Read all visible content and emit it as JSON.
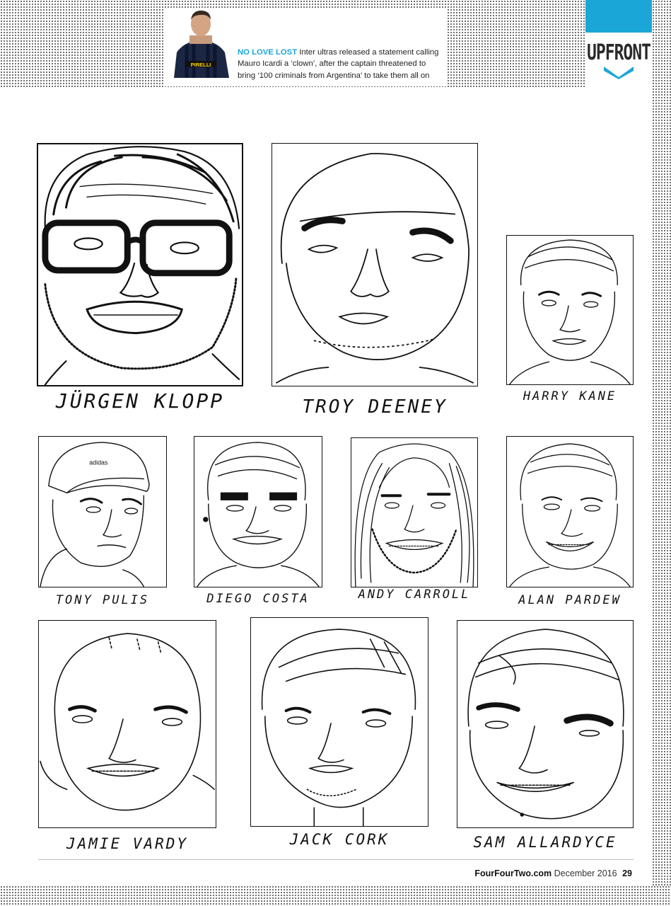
{
  "section": {
    "label": "UPFRONT"
  },
  "news_item": {
    "kicker": "NO LOVE LOST",
    "body": "Inter ultras released a statement calling Mauro Icardi a ‘clown’, after the captain threatened to bring ‘100 criminals from Argentina’ to take them all on",
    "photo_shirt_text": "PIRELLI"
  },
  "portraits": [
    {
      "name": "JÜRGEN KLOPP"
    },
    {
      "name": "TROY DEENEY"
    },
    {
      "name": "HARRY KANE"
    },
    {
      "name": "TONY PULIS"
    },
    {
      "name": "DIEGO COSTA"
    },
    {
      "name": "ANDY CARROLL"
    },
    {
      "name": "ALAN PARDEW"
    },
    {
      "name": "JAMIE VARDY"
    },
    {
      "name": "JACK CORK"
    },
    {
      "name": "SAM ALLARDYCE"
    }
  ],
  "cap_text": "adidas",
  "footer": {
    "site": "FourFourTwo.com",
    "issue": "December 2016",
    "page_number": "29"
  },
  "colors": {
    "accent": "#1aa6d6",
    "ink": "#111111",
    "dots": "#5a5a5a"
  }
}
